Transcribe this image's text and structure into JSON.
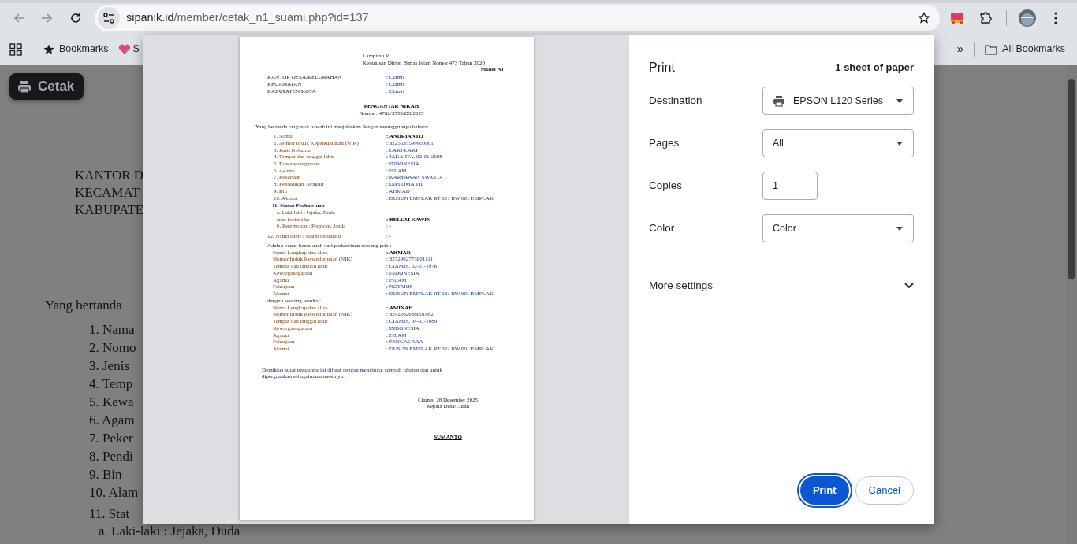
{
  "browser": {
    "nav_buttons": [
      {
        "kind": "back",
        "disabled": true
      },
      {
        "kind": "forward",
        "disabled": true
      },
      {
        "kind": "reload",
        "disabled": false
      }
    ],
    "url": {
      "host": "sipanik.id",
      "path": "/member/cetak_n1_suami.php?id=137"
    },
    "bookmarks": [
      {
        "kind": "star",
        "label": "Bookmarks"
      },
      {
        "kind": "heart",
        "label": "S"
      }
    ],
    "overflow": "»",
    "all_bookmarks": "All Bookmarks"
  },
  "page": {
    "print_button": "Cetak",
    "header_lines": [
      "KANTOR D",
      "KECAMAT",
      "KABUPATE"
    ],
    "intro": "Yang bertanda",
    "items": [
      "1. Nama",
      "2. Nomo",
      "3. Jenis",
      "4. Temp",
      "5. Kewa",
      "6. Agam",
      "7. Peker",
      "8. Pendi",
      "9. Bin",
      "10. Alam"
    ],
    "section": "11. Stat",
    "sub_item": "a. Laki-laki : Jejaka, Duda"
  },
  "print_dialog": {
    "title": "Print",
    "sheets": "1 sheet of paper",
    "settings": [
      {
        "kind": "destination",
        "label": "Destination",
        "value": "EPSON L120 Series"
      },
      {
        "kind": "select",
        "label": "Pages",
        "value": "All"
      },
      {
        "kind": "number",
        "label": "Copies",
        "value": "1"
      },
      {
        "kind": "select",
        "label": "Color",
        "value": "Color"
      }
    ],
    "more_settings": {
      "label": "More settings",
      "expanded": false
    },
    "buttons": [
      {
        "kind": "primary",
        "label": "Print",
        "focused": true
      },
      {
        "kind": "secondary",
        "label": "Cancel",
        "focused": false
      }
    ]
  },
  "document": {
    "header_lines": [
      "Lampiran V",
      "Keputusan Dirjen Bimas Islam Nomor 473 Tahun 2020"
    ],
    "model": "Model N1",
    "region": [
      {
        "label": "KANTOR DESA/KELURAHAN",
        "value": ": Ciamis"
      },
      {
        "label": "KECAMATAN",
        "value": ": Ciamis"
      },
      {
        "label": "KABUPATEN/KOTA",
        "value": ": Ciamis"
      }
    ],
    "title": "PENGANTAR NIKAH",
    "number": "Nomor : 4762/3553/DS/2025",
    "intro": "Yang bertanda tangan di bawah ini menjelaskan dengan sesungguhnya bahwa:",
    "fields": [
      {
        "label": "1. Nama",
        "value": ": ANDRIANTO",
        "bold": true
      },
      {
        "label": "2. Nomor Induk Kependudukan (NIK)",
        "value": ": 3225535599900001",
        "bold": false
      },
      {
        "label": "3. Jenis Kelamin",
        "value": ": LAKI-LAKI",
        "bold": false
      },
      {
        "label": "4. Tempat dan tanggal lahir",
        "value": ": JAKARTA, 02-01-2008",
        "bold": false
      },
      {
        "label": "5. Kewarganegaraan",
        "value": ": INDONESIA",
        "bold": false
      },
      {
        "label": "6. Agama",
        "value": ": ISLAM",
        "bold": false
      },
      {
        "label": "7. Pekerjaan",
        "value": ": KARYAWAN SWASTA",
        "bold": false
      },
      {
        "label": "8. Pendidikan Terakhir",
        "value": ": DIPLOMA I/II",
        "bold": false
      },
      {
        "label": "9. Bin",
        "value": ": AHMAD",
        "bold": false
      },
      {
        "label": "10. Alamat",
        "value": ": DUSUN EMPLAK RT 021 RW 001 EMPLAK",
        "bold": false
      }
    ],
    "status": {
      "heading": "11. Status Perkawinan",
      "rows": [
        {
          "label": "a. Laki-laki : Jejaka, Duda"
        },
        {
          "label": "atau beristri ke",
          "value": ": BELUM KAWIN",
          "bold": true
        },
        {
          "label": "b. Perempuan : Perawan, Janda",
          "value": ": -",
          "bold": false
        }
      ]
    },
    "previous_spouse": {
      "label": "12. Nama isteri / suami terdahulu",
      "value": ": -"
    },
    "father": {
      "intro": "Adalah benar-benar anak dari perkawinan seorang pria :",
      "fields": [
        {
          "label": "Nama Lengkap dan alias",
          "value": ": AHMAD",
          "bold": true
        },
        {
          "label": "Nomor Induk Kependudukan (NIK)",
          "value": ": 3272992773001111",
          "bold": false
        },
        {
          "label": "Tempat dan tanggal lahir",
          "value": ": CIAMIS, 02-01-1976",
          "bold": false
        },
        {
          "label": "Kewarganegaraan",
          "value": ": INDONESIA",
          "bold": false
        },
        {
          "label": "Agama",
          "value": ": ISLAM",
          "bold": false
        },
        {
          "label": "Pekerjaan",
          "value": ": NOTARIS",
          "bold": false
        },
        {
          "label": "Alamat",
          "value": ": DUSUN EMPLAK RT 021 RW 001 EMPLAK",
          "bold": false
        }
      ]
    },
    "mother": {
      "intro": "dengan seorang wanita :",
      "fields": [
        {
          "label": "Nama Lengkap dan alias",
          "value": ": AMINAH",
          "bold": true
        },
        {
          "label": "Nomor Induk Kependudukan (NIK)",
          "value": ": 3242262688001882",
          "bold": false
        },
        {
          "label": "Tempat dan tanggal lahir",
          "value": ": CIAMIS, 04-01-1989",
          "bold": false
        },
        {
          "label": "Kewarganegaraan",
          "value": ": INDONESIA",
          "bold": false
        },
        {
          "label": "Agama",
          "value": ": ISLAM",
          "bold": false
        },
        {
          "label": "Pekerjaan",
          "value": ": PENGACARA",
          "bold": false
        },
        {
          "label": "Alamat",
          "value": ": DUSUN EMPLAK RT 021 RW 001 EMPLAK",
          "bold": false
        }
      ]
    },
    "closing": "Demikian surat pengantar ini dibuat dengan mengingat sumpah jabatan dan untuk dipergunakan sebagaimana mestinya.",
    "place_date": "Ciamis, 28 Desember 2025",
    "position": "Kepala Desa/Lurah",
    "signer": "SUMANTO"
  }
}
